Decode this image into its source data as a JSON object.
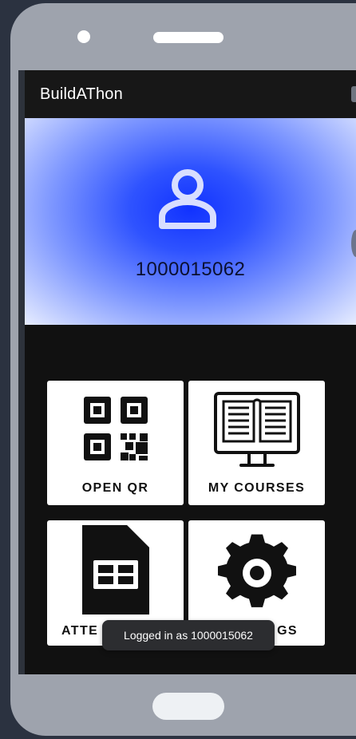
{
  "app": {
    "title": "BuildAThon"
  },
  "profile": {
    "user_id": "1000015062",
    "avatar_icon": "person-icon"
  },
  "menu": {
    "tiles": [
      {
        "label": "OPEN QR",
        "icon": "qr-code-icon"
      },
      {
        "label": "MY COURSES",
        "icon": "course-monitor-icon"
      },
      {
        "label": "ATTE",
        "icon": "spreadsheet-icon"
      },
      {
        "label": "GS",
        "icon": "gear-icon"
      }
    ]
  },
  "toast": {
    "message": "Logged in as 1000015062"
  },
  "colors": {
    "banner_accent": "#1132ff",
    "screen_background": "#111111",
    "device_frame": "#9ea3ad"
  }
}
